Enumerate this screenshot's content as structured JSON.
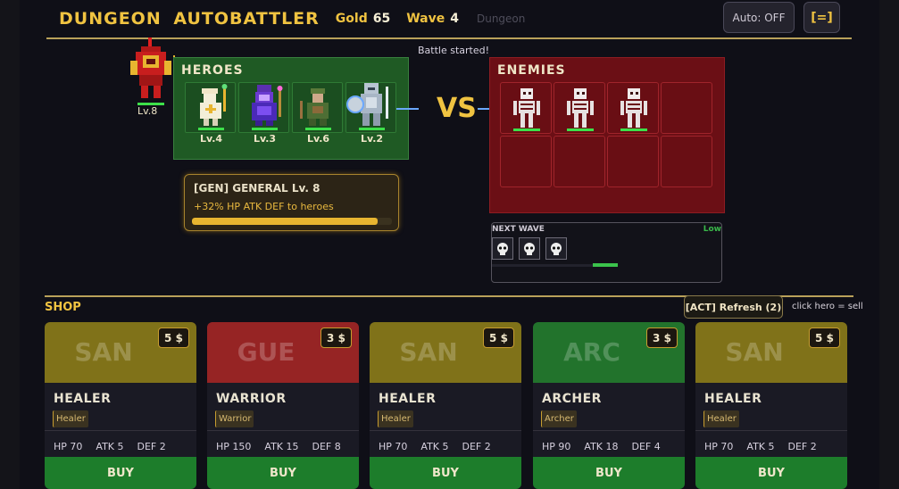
{
  "header": {
    "title": "DUNGEON AUTOBATTLER",
    "gold_label": "Gold",
    "gold_value": "65",
    "wave_label": "Wave",
    "wave_value": "4",
    "location": "Dungeon",
    "auto_button": "Auto: OFF",
    "menu_button": "[=]"
  },
  "battle_message": "Battle started!",
  "general": {
    "level": "Lv.8"
  },
  "heroes": {
    "title": "HEROES",
    "slots": [
      {
        "level": "Lv.4",
        "class_icon": "healer-icon"
      },
      {
        "level": "Lv.3",
        "class_icon": "mage-icon"
      },
      {
        "level": "Lv.6",
        "class_icon": "archer-icon"
      },
      {
        "level": "Lv.2",
        "class_icon": "knight-icon"
      }
    ]
  },
  "vs_label": "VS",
  "enemies": {
    "title": "ENEMIES",
    "slots": [
      {
        "icon": "skeleton-icon",
        "filled": true
      },
      {
        "icon": "skeleton-icon",
        "filled": true
      },
      {
        "icon": "skeleton-icon",
        "filled": true
      },
      {
        "filled": false
      },
      {
        "filled": false
      },
      {
        "filled": false
      },
      {
        "filled": false
      },
      {
        "filled": false
      }
    ]
  },
  "general_card": {
    "title": "[GEN]  GENERAL  Lv. 8",
    "bonus": "+32% HP ATK DEF to heroes",
    "progress": 0.93
  },
  "next_wave": {
    "label": "NEXT WAVE",
    "threat": "Low",
    "enemy_icons": [
      "skull-icon",
      "skull-icon",
      "skull-icon"
    ]
  },
  "shop": {
    "label": "SHOP",
    "refresh_button": "[ACT]  Refresh  (2)",
    "hint": "click hero = sell",
    "cards": [
      {
        "abbr": "SAN",
        "cost": "5 $",
        "name": "HEALER",
        "tag": "Healer",
        "hp": "HP 70",
        "atk": "ATK 5",
        "def": "DEF 2",
        "buy": "BUY",
        "color": "#807219"
      },
      {
        "abbr": "GUE",
        "cost": "3 $",
        "name": "WARRIOR",
        "tag": "Warrior",
        "hp": "HP 150",
        "atk": "ATK 15",
        "def": "DEF 8",
        "buy": "BUY",
        "color": "#962424"
      },
      {
        "abbr": "SAN",
        "cost": "5 $",
        "name": "HEALER",
        "tag": "Healer",
        "hp": "HP 70",
        "atk": "ATK 5",
        "def": "DEF 2",
        "buy": "BUY",
        "color": "#807219"
      },
      {
        "abbr": "ARC",
        "cost": "3 $",
        "name": "ARCHER",
        "tag": "Archer",
        "hp": "HP 90",
        "atk": "ATK 18",
        "def": "DEF 4",
        "buy": "BUY",
        "color": "#22732c"
      },
      {
        "abbr": "SAN",
        "cost": "5 $",
        "name": "HEALER",
        "tag": "Healer",
        "hp": "HP 70",
        "atk": "ATK 5",
        "def": "DEF 2",
        "buy": "BUY",
        "color": "#807219"
      }
    ]
  }
}
